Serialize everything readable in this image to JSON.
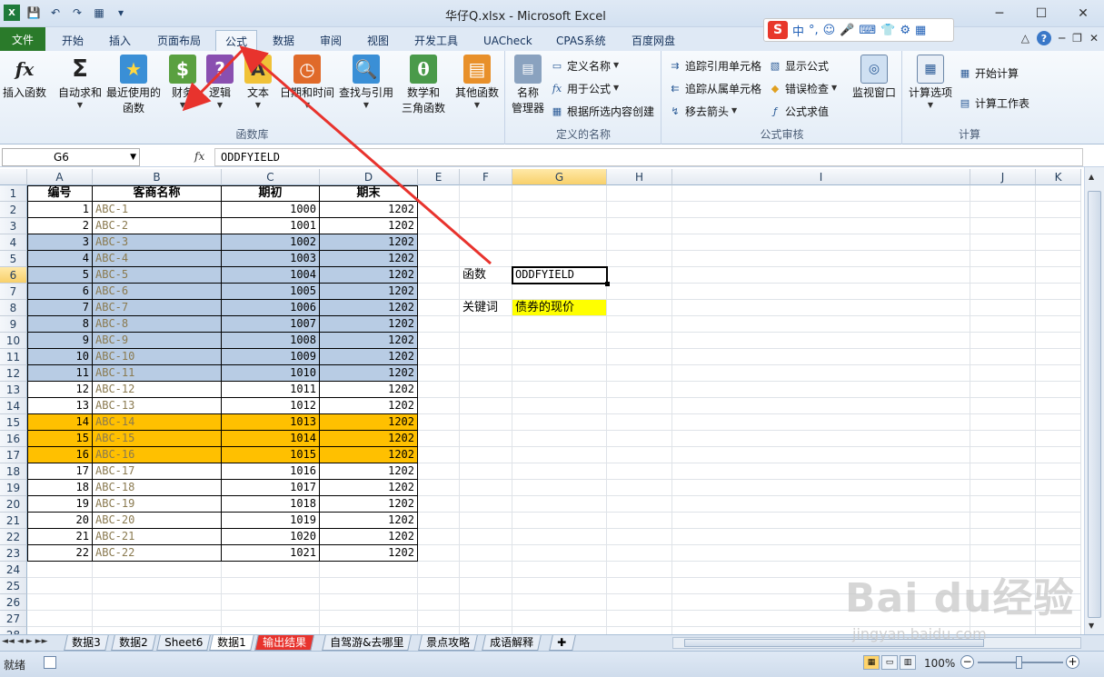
{
  "window": {
    "title": "华仔Q.xlsx - Microsoft Excel",
    "minimize": "─",
    "maximize": "☐",
    "close": "✕"
  },
  "qat": {
    "app_icon": "excel-icon",
    "save_icon": "💾",
    "undo_icon": "↶",
    "redo_icon": "↷",
    "extra_icon": "▦",
    "more_icon": "▾"
  },
  "ime": {
    "logo": "S",
    "items": [
      "中",
      "°,",
      "☺",
      "🎤",
      "⌨",
      "👕",
      "⚙",
      "▦"
    ]
  },
  "tabs": [
    {
      "label": "文件",
      "kind": "file"
    },
    {
      "label": "开始"
    },
    {
      "label": "插入"
    },
    {
      "label": "页面布局"
    },
    {
      "label": "公式",
      "active": true
    },
    {
      "label": "数据"
    },
    {
      "label": "审阅"
    },
    {
      "label": "视图"
    },
    {
      "label": "开发工具"
    },
    {
      "label": "UACheck"
    },
    {
      "label": "CPAS系统"
    },
    {
      "label": "百度网盘"
    }
  ],
  "tab_right": {
    "caret": "△",
    "help": "?",
    "min": "─",
    "restore": "❐",
    "close": "✕"
  },
  "ribbon": {
    "function_library": {
      "label": "函数库",
      "insert_function": {
        "icon": "fx",
        "label": "插入函数"
      },
      "autosum": {
        "icon": "Σ",
        "label": "自动求和"
      },
      "recent": {
        "icon": "★",
        "label1": "最近使用的",
        "label2": "函数"
      },
      "financial": {
        "icon": "$",
        "label": "财务"
      },
      "logical": {
        "icon": "?",
        "label": "逻辑"
      },
      "text": {
        "icon": "A",
        "label": "文本"
      },
      "datetime": {
        "icon": "◷",
        "label": "日期和时间"
      },
      "lookup": {
        "icon": "🔍",
        "label": "查找与引用"
      },
      "math": {
        "icon": "θ",
        "label1": "数学和",
        "label2": "三角函数"
      },
      "more": {
        "icon": "▤",
        "label": "其他函数"
      }
    },
    "defined_names": {
      "label": "定义的名称",
      "name_manager": {
        "label1": "名称",
        "label2": "管理器"
      },
      "define_name": "定义名称",
      "use_in_formula": "用于公式",
      "create_from_selection": "根据所选内容创建"
    },
    "formula_auditing": {
      "label": "公式审核",
      "trace_precedents": "追踪引用单元格",
      "trace_dependents": "追踪从属单元格",
      "remove_arrows": "移去箭头",
      "show_formulas": "显示公式",
      "error_checking": "错误检查",
      "evaluate_formula": "公式求值",
      "watch_window": "监视窗口"
    },
    "calculation": {
      "label": "计算",
      "options": "计算选项",
      "calc_now": "开始计算",
      "calc_sheet": "计算工作表"
    }
  },
  "formula_bar": {
    "name_box": "G6",
    "fx": "fx",
    "content": "ODDFYIELD"
  },
  "columns": [
    "A",
    "B",
    "C",
    "D",
    "E",
    "F",
    "G",
    "H",
    "I",
    "J",
    "K"
  ],
  "selected_column": "G",
  "selected_row": 6,
  "table": {
    "headers": [
      "编号",
      "客商名称",
      "期初",
      "期末"
    ],
    "rows": [
      [
        1,
        "ABC-1",
        1000,
        1202
      ],
      [
        2,
        "ABC-2",
        1001,
        1202
      ],
      [
        3,
        "ABC-3",
        1002,
        1202
      ],
      [
        4,
        "ABC-4",
        1003,
        1202
      ],
      [
        5,
        "ABC-5",
        1004,
        1202
      ],
      [
        6,
        "ABC-6",
        1005,
        1202
      ],
      [
        7,
        "ABC-7",
        1006,
        1202
      ],
      [
        8,
        "ABC-8",
        1007,
        1202
      ],
      [
        9,
        "ABC-9",
        1008,
        1202
      ],
      [
        10,
        "ABC-10",
        1009,
        1202
      ],
      [
        11,
        "ABC-11",
        1010,
        1202
      ],
      [
        12,
        "ABC-12",
        1011,
        1202
      ],
      [
        13,
        "ABC-13",
        1012,
        1202
      ],
      [
        14,
        "ABC-14",
        1013,
        1202
      ],
      [
        15,
        "ABC-15",
        1014,
        1202
      ],
      [
        16,
        "ABC-16",
        1015,
        1202
      ],
      [
        17,
        "ABC-17",
        1016,
        1202
      ],
      [
        18,
        "ABC-18",
        1017,
        1202
      ],
      [
        19,
        "ABC-19",
        1018,
        1202
      ],
      [
        20,
        "ABC-20",
        1019,
        1202
      ],
      [
        21,
        "ABC-21",
        1020,
        1202
      ],
      [
        22,
        "ABC-22",
        1021,
        1202
      ]
    ],
    "blue_rows": [
      3,
      4,
      5,
      6,
      7,
      8,
      9,
      10,
      11
    ],
    "orange_rows": [
      14,
      15,
      16
    ],
    "blue_color": "#b8cce4",
    "orange_color": "#ffc000"
  },
  "side_cells": {
    "function_label": "函数",
    "function_value": "ODDFYIELD",
    "keyword_label": "关键词",
    "keyword_value": "债券的现价",
    "keyword_bg": "#ffff00"
  },
  "sheets": [
    {
      "label": "数据3"
    },
    {
      "label": "数据2"
    },
    {
      "label": "Sheet6"
    },
    {
      "label": "数据1",
      "active": true
    },
    {
      "label": "输出结果",
      "red": true
    },
    {
      "label": "自驾游&去哪里"
    },
    {
      "label": "景点攻略"
    },
    {
      "label": "成语解释"
    }
  ],
  "sheet_nav": [
    "◄◄",
    "◄",
    "►",
    "►►"
  ],
  "status": {
    "ready": "就绪",
    "zoom": "100%"
  },
  "watermark": {
    "main": "Bai du经验",
    "sub": "jingyan.baidu.com"
  },
  "annotation_color": "#e8332d"
}
